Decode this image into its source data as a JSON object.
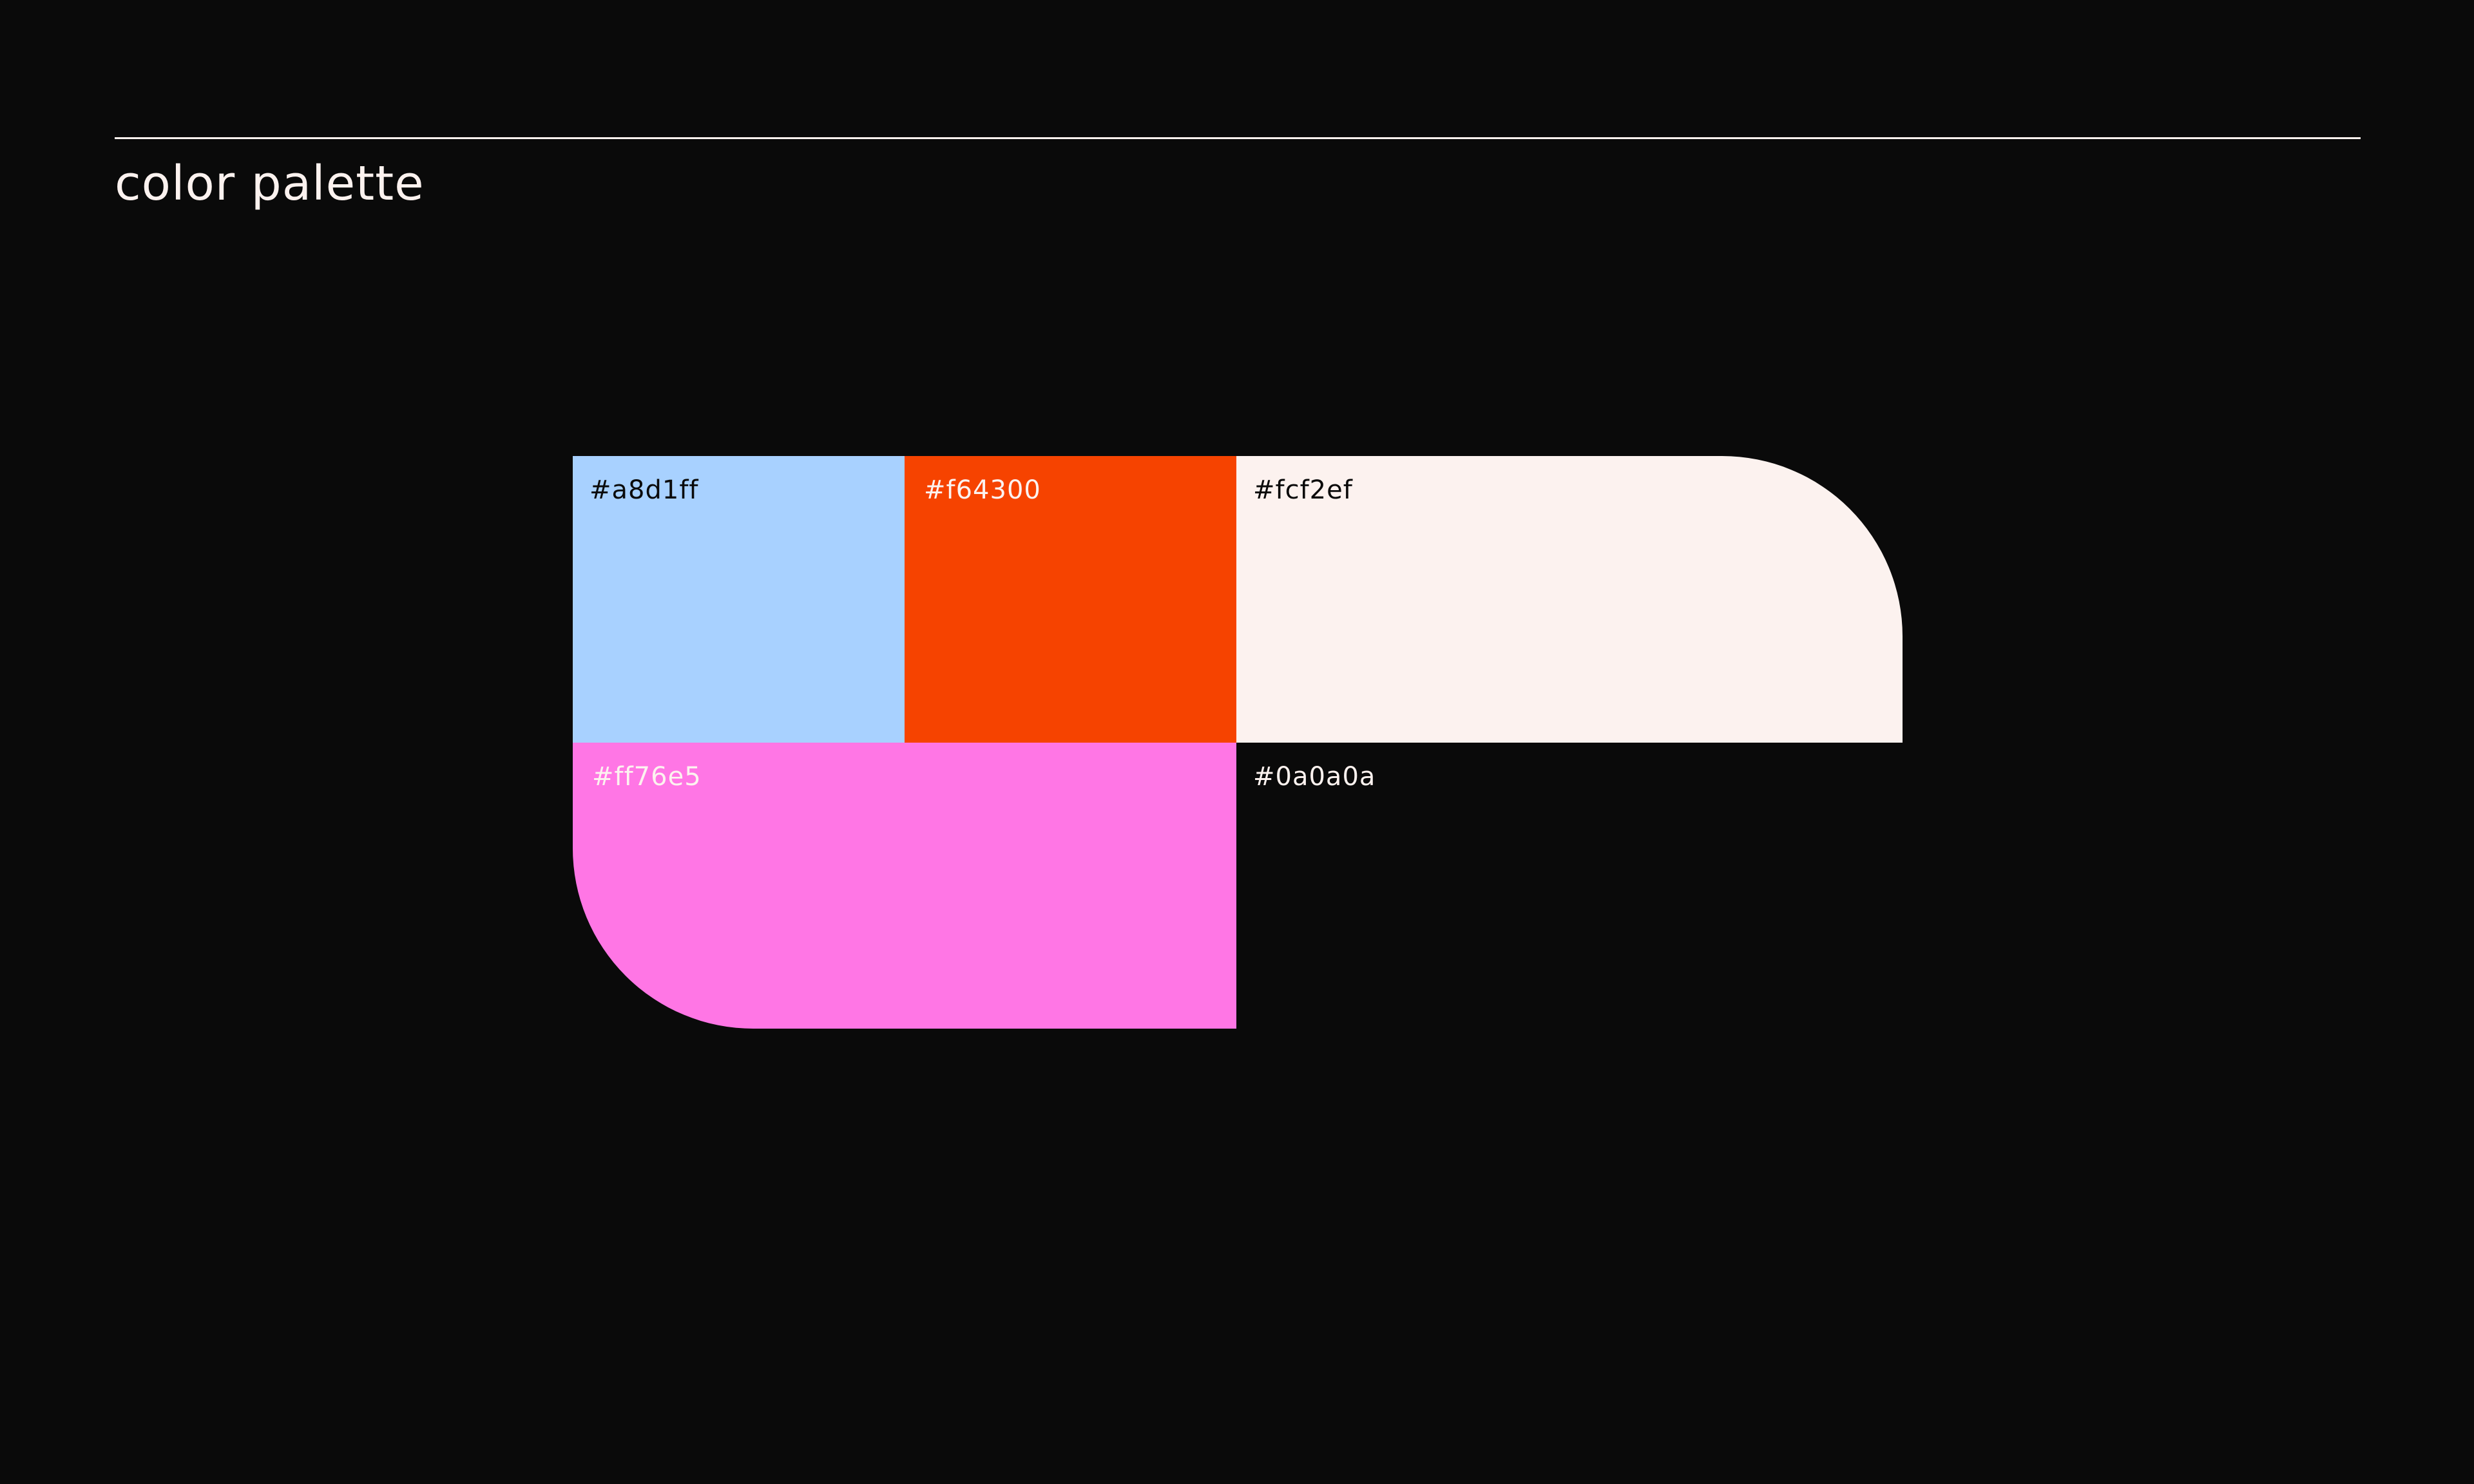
{
  "header": {
    "title": "color palette"
  },
  "palette": {
    "swatches": [
      {
        "label": "#a8d1ff",
        "color": "#a8d1ff",
        "text_color": "#0a0a0a"
      },
      {
        "label": "#f64300",
        "color": "#f64300",
        "text_color": "#fcf2ef"
      },
      {
        "label": "#fcf2ef",
        "color": "#fcf2ef",
        "text_color": "#0a0a0a"
      },
      {
        "label": "#ff76e5",
        "color": "#ff76e5",
        "text_color": "#fcf2ef"
      },
      {
        "label": "#0a0a0a",
        "color": "#0a0a0a",
        "text_color": "#fcf2ef"
      }
    ]
  },
  "colors": {
    "background": "#0a0a0a",
    "rule": "#fcf2ef",
    "title": "#fcf2ef"
  }
}
